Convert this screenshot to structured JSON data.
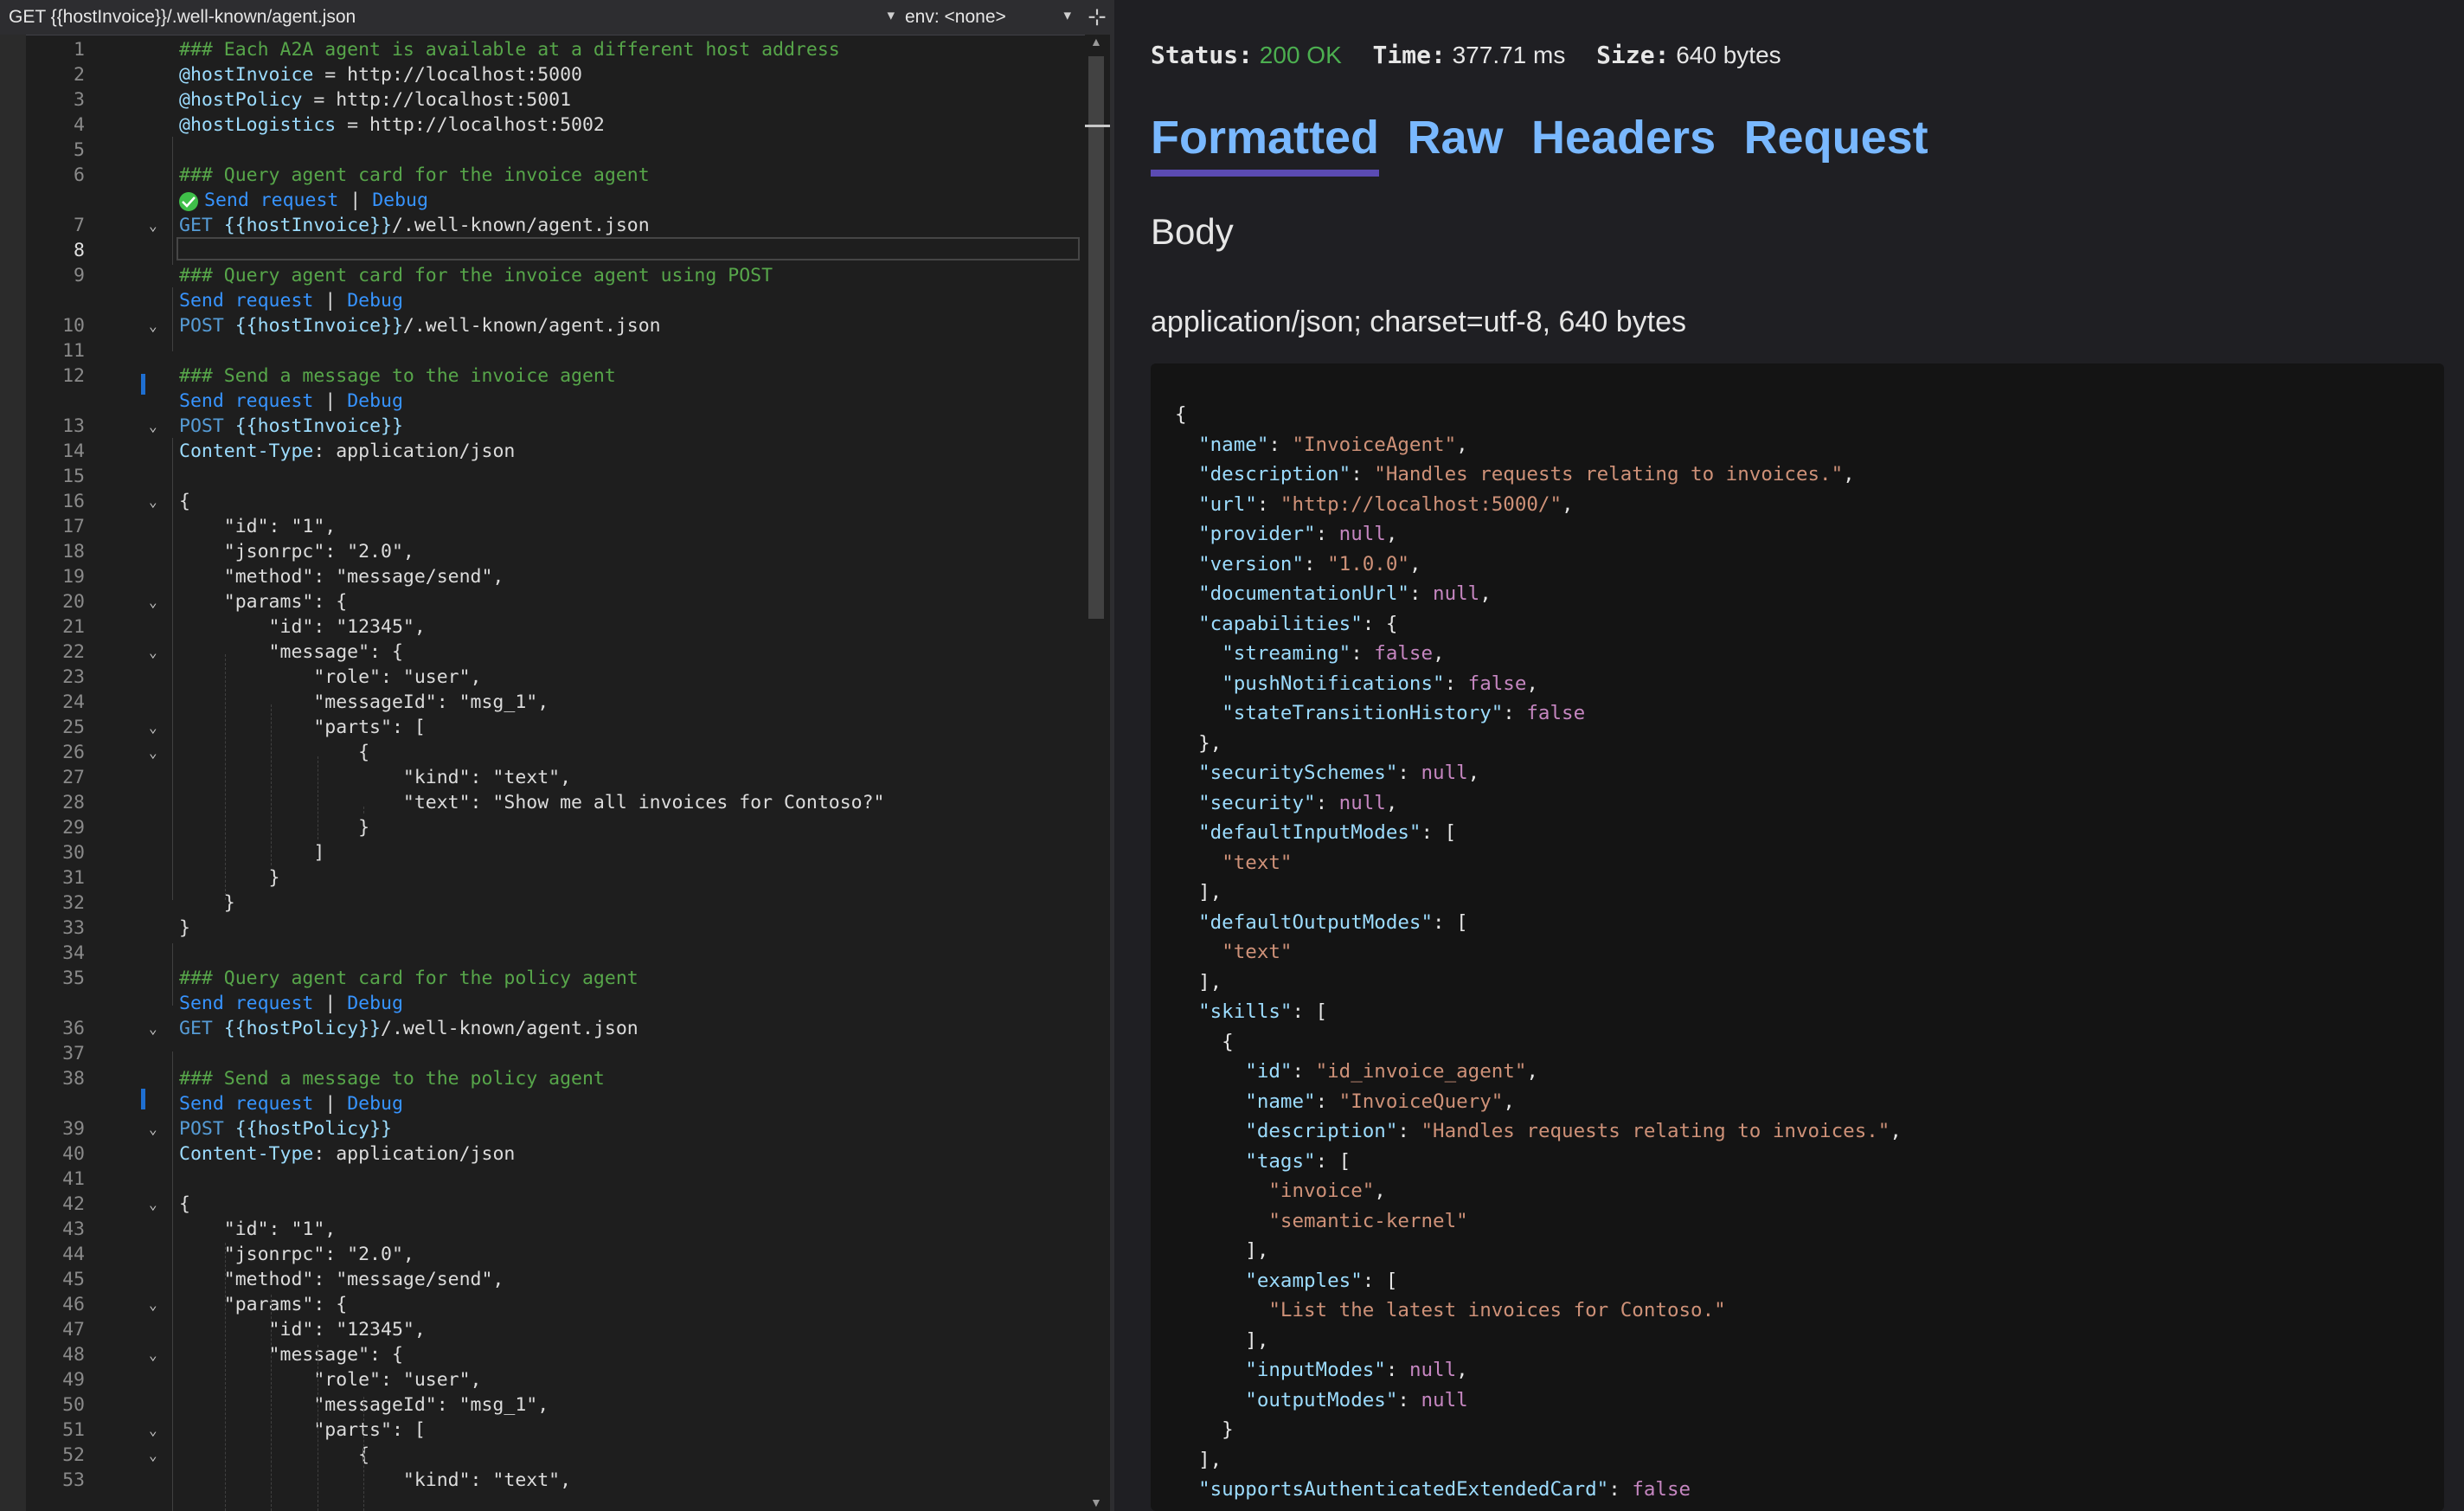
{
  "editor": {
    "request_selector": "GET {{hostInvoice}}/.well-known/agent.json",
    "env_selector": "env: <none>",
    "lines": [
      {
        "n": "1",
        "parts": [
          [
            "comment",
            "### Each A2A agent is available at a different host address"
          ]
        ]
      },
      {
        "n": "2",
        "parts": [
          [
            "var",
            "@hostInvoice"
          ],
          [
            "white",
            " = http://localhost:5000"
          ]
        ]
      },
      {
        "n": "3",
        "parts": [
          [
            "var",
            "@hostPolicy"
          ],
          [
            "white",
            " = http://localhost:5001"
          ]
        ]
      },
      {
        "n": "4",
        "parts": [
          [
            "var",
            "@hostLogistics"
          ],
          [
            "white",
            " = http://localhost:5002"
          ]
        ]
      },
      {
        "n": "5",
        "parts": []
      },
      {
        "n": "6",
        "parts": [
          [
            "comment",
            "### Query agent card for the invoice agent"
          ]
        ]
      },
      {
        "n": "",
        "codelens": true,
        "check": true,
        "send": "Send request",
        "debug": "Debug"
      },
      {
        "n": "7",
        "fold": true,
        "parts": [
          [
            "kw",
            "GET "
          ],
          [
            "var",
            "{{hostInvoice}}"
          ],
          [
            "white",
            "/.well-known/agent.json"
          ]
        ]
      },
      {
        "n": "8",
        "current": true,
        "parts": []
      },
      {
        "n": "9",
        "parts": [
          [
            "comment",
            "### Query agent card for the invoice agent using POST"
          ]
        ]
      },
      {
        "n": "",
        "codelens": true,
        "send": "Send request",
        "debug": "Debug"
      },
      {
        "n": "10",
        "fold": true,
        "parts": [
          [
            "kw",
            "POST "
          ],
          [
            "var",
            "{{hostInvoice}}"
          ],
          [
            "white",
            "/.well-known/agent.json"
          ]
        ]
      },
      {
        "n": "11",
        "parts": []
      },
      {
        "n": "12",
        "parts": [
          [
            "comment",
            "### Send a message to the invoice agent"
          ]
        ]
      },
      {
        "n": "",
        "codelens": true,
        "send": "Send request",
        "debug": "Debug"
      },
      {
        "n": "13",
        "fold": true,
        "parts": [
          [
            "kw",
            "POST "
          ],
          [
            "var",
            "{{hostInvoice}}"
          ]
        ]
      },
      {
        "n": "14",
        "parts": [
          [
            "var",
            "Content-Type"
          ],
          [
            "white",
            ": application/json"
          ]
        ]
      },
      {
        "n": "15",
        "parts": []
      },
      {
        "n": "16",
        "fold": true,
        "parts": [
          [
            "white",
            "{"
          ]
        ]
      },
      {
        "n": "17",
        "parts": [
          [
            "white",
            "    \"id\": \"1\","
          ]
        ]
      },
      {
        "n": "18",
        "parts": [
          [
            "white",
            "    \"jsonrpc\": \"2.0\","
          ]
        ]
      },
      {
        "n": "19",
        "parts": [
          [
            "white",
            "    \"method\": \"message/send\","
          ]
        ]
      },
      {
        "n": "20",
        "fold": true,
        "parts": [
          [
            "white",
            "    \"params\": {"
          ]
        ]
      },
      {
        "n": "21",
        "parts": [
          [
            "white",
            "        \"id\": \"12345\","
          ]
        ]
      },
      {
        "n": "22",
        "fold": true,
        "parts": [
          [
            "white",
            "        \"message\": {"
          ]
        ]
      },
      {
        "n": "23",
        "parts": [
          [
            "white",
            "            \"role\": \"user\","
          ]
        ]
      },
      {
        "n": "24",
        "parts": [
          [
            "white",
            "            \"messageId\": \"msg_1\","
          ]
        ]
      },
      {
        "n": "25",
        "fold": true,
        "parts": [
          [
            "white",
            "            \"parts\": ["
          ]
        ]
      },
      {
        "n": "26",
        "fold": true,
        "parts": [
          [
            "white",
            "                {"
          ]
        ]
      },
      {
        "n": "27",
        "parts": [
          [
            "white",
            "                    \"kind\": \"text\","
          ]
        ]
      },
      {
        "n": "28",
        "parts": [
          [
            "white",
            "                    \"text\": \"Show me all invoices for Contoso?\""
          ]
        ]
      },
      {
        "n": "29",
        "parts": [
          [
            "white",
            "                }"
          ]
        ]
      },
      {
        "n": "30",
        "parts": [
          [
            "white",
            "            ]"
          ]
        ]
      },
      {
        "n": "31",
        "parts": [
          [
            "white",
            "        }"
          ]
        ]
      },
      {
        "n": "32",
        "parts": [
          [
            "white",
            "    }"
          ]
        ]
      },
      {
        "n": "33",
        "parts": [
          [
            "white",
            "}"
          ]
        ]
      },
      {
        "n": "34",
        "parts": []
      },
      {
        "n": "35",
        "parts": [
          [
            "comment",
            "### Query agent card for the policy agent"
          ]
        ]
      },
      {
        "n": "",
        "codelens": true,
        "send": "Send request",
        "debug": "Debug"
      },
      {
        "n": "36",
        "fold": true,
        "parts": [
          [
            "kw",
            "GET "
          ],
          [
            "var",
            "{{hostPolicy}}"
          ],
          [
            "white",
            "/.well-known/agent.json"
          ]
        ]
      },
      {
        "n": "37",
        "parts": []
      },
      {
        "n": "38",
        "parts": [
          [
            "comment",
            "### Send a message to the policy agent"
          ]
        ]
      },
      {
        "n": "",
        "codelens": true,
        "send": "Send request",
        "debug": "Debug"
      },
      {
        "n": "39",
        "fold": true,
        "parts": [
          [
            "kw",
            "POST "
          ],
          [
            "var",
            "{{hostPolicy}}"
          ]
        ]
      },
      {
        "n": "40",
        "parts": [
          [
            "var",
            "Content-Type"
          ],
          [
            "white",
            ": application/json"
          ]
        ]
      },
      {
        "n": "41",
        "parts": []
      },
      {
        "n": "42",
        "fold": true,
        "parts": [
          [
            "white",
            "{"
          ]
        ]
      },
      {
        "n": "43",
        "parts": [
          [
            "white",
            "    \"id\": \"1\","
          ]
        ]
      },
      {
        "n": "44",
        "parts": [
          [
            "white",
            "    \"jsonrpc\": \"2.0\","
          ]
        ]
      },
      {
        "n": "45",
        "parts": [
          [
            "white",
            "    \"method\": \"message/send\","
          ]
        ]
      },
      {
        "n": "46",
        "fold": true,
        "parts": [
          [
            "white",
            "    \"params\": {"
          ]
        ]
      },
      {
        "n": "47",
        "parts": [
          [
            "white",
            "        \"id\": \"12345\","
          ]
        ]
      },
      {
        "n": "48",
        "fold": true,
        "parts": [
          [
            "white",
            "        \"message\": {"
          ]
        ]
      },
      {
        "n": "49",
        "parts": [
          [
            "white",
            "            \"role\": \"user\","
          ]
        ]
      },
      {
        "n": "50",
        "parts": [
          [
            "white",
            "            \"messageId\": \"msg_1\","
          ]
        ]
      },
      {
        "n": "51",
        "fold": true,
        "parts": [
          [
            "white",
            "            \"parts\": ["
          ]
        ]
      },
      {
        "n": "52",
        "fold": true,
        "parts": [
          [
            "white",
            "                {"
          ]
        ]
      },
      {
        "n": "53",
        "parts": [
          [
            "white",
            "                    \"kind\": \"text\","
          ]
        ]
      }
    ]
  },
  "response": {
    "status_label": "Status:",
    "status_value": "200 OK",
    "time_label": "Time:",
    "time_value": "377.71 ms",
    "size_label": "Size:",
    "size_value": "640 bytes",
    "tabs": [
      "Formatted",
      "Raw",
      "Headers",
      "Request"
    ],
    "active_tab": "Formatted",
    "body_heading": "Body",
    "content_type": "application/json; charset=utf-8, 640 bytes",
    "json_lines": [
      [
        [
          "p",
          "{"
        ]
      ],
      [
        [
          "p",
          "  "
        ],
        [
          "k",
          "\"name\""
        ],
        [
          "p",
          ": "
        ],
        [
          "s",
          "\"InvoiceAgent\""
        ],
        [
          "p",
          ","
        ]
      ],
      [
        [
          "p",
          "  "
        ],
        [
          "k",
          "\"description\""
        ],
        [
          "p",
          ": "
        ],
        [
          "s",
          "\"Handles requests relating to invoices.\""
        ],
        [
          "p",
          ","
        ]
      ],
      [
        [
          "p",
          "  "
        ],
        [
          "k",
          "\"url\""
        ],
        [
          "p",
          ": "
        ],
        [
          "s",
          "\"http://localhost:5000/\""
        ],
        [
          "p",
          ","
        ]
      ],
      [
        [
          "p",
          "  "
        ],
        [
          "k",
          "\"provider\""
        ],
        [
          "p",
          ": "
        ],
        [
          "v",
          "null"
        ],
        [
          "p",
          ","
        ]
      ],
      [
        [
          "p",
          "  "
        ],
        [
          "k",
          "\"version\""
        ],
        [
          "p",
          ": "
        ],
        [
          "s",
          "\"1.0.0\""
        ],
        [
          "p",
          ","
        ]
      ],
      [
        [
          "p",
          "  "
        ],
        [
          "k",
          "\"documentationUrl\""
        ],
        [
          "p",
          ": "
        ],
        [
          "v",
          "null"
        ],
        [
          "p",
          ","
        ]
      ],
      [
        [
          "p",
          "  "
        ],
        [
          "k",
          "\"capabilities\""
        ],
        [
          "p",
          ": {"
        ]
      ],
      [
        [
          "p",
          "    "
        ],
        [
          "k",
          "\"streaming\""
        ],
        [
          "p",
          ": "
        ],
        [
          "v",
          "false"
        ],
        [
          "p",
          ","
        ]
      ],
      [
        [
          "p",
          "    "
        ],
        [
          "k",
          "\"pushNotifications\""
        ],
        [
          "p",
          ": "
        ],
        [
          "v",
          "false"
        ],
        [
          "p",
          ","
        ]
      ],
      [
        [
          "p",
          "    "
        ],
        [
          "k",
          "\"stateTransitionHistory\""
        ],
        [
          "p",
          ": "
        ],
        [
          "v",
          "false"
        ]
      ],
      [
        [
          "p",
          "  },"
        ]
      ],
      [
        [
          "p",
          "  "
        ],
        [
          "k",
          "\"securitySchemes\""
        ],
        [
          "p",
          ": "
        ],
        [
          "v",
          "null"
        ],
        [
          "p",
          ","
        ]
      ],
      [
        [
          "p",
          "  "
        ],
        [
          "k",
          "\"security\""
        ],
        [
          "p",
          ": "
        ],
        [
          "v",
          "null"
        ],
        [
          "p",
          ","
        ]
      ],
      [
        [
          "p",
          "  "
        ],
        [
          "k",
          "\"defaultInputModes\""
        ],
        [
          "p",
          ": ["
        ]
      ],
      [
        [
          "p",
          "    "
        ],
        [
          "s",
          "\"text\""
        ]
      ],
      [
        [
          "p",
          "  ],"
        ]
      ],
      [
        [
          "p",
          "  "
        ],
        [
          "k",
          "\"defaultOutputModes\""
        ],
        [
          "p",
          ": ["
        ]
      ],
      [
        [
          "p",
          "    "
        ],
        [
          "s",
          "\"text\""
        ]
      ],
      [
        [
          "p",
          "  ],"
        ]
      ],
      [
        [
          "p",
          "  "
        ],
        [
          "k",
          "\"skills\""
        ],
        [
          "p",
          ": ["
        ]
      ],
      [
        [
          "p",
          "    {"
        ]
      ],
      [
        [
          "p",
          "      "
        ],
        [
          "k",
          "\"id\""
        ],
        [
          "p",
          ": "
        ],
        [
          "s",
          "\"id_invoice_agent\""
        ],
        [
          "p",
          ","
        ]
      ],
      [
        [
          "p",
          "      "
        ],
        [
          "k",
          "\"name\""
        ],
        [
          "p",
          ": "
        ],
        [
          "s",
          "\"InvoiceQuery\""
        ],
        [
          "p",
          ","
        ]
      ],
      [
        [
          "p",
          "      "
        ],
        [
          "k",
          "\"description\""
        ],
        [
          "p",
          ": "
        ],
        [
          "s",
          "\"Handles requests relating to invoices.\""
        ],
        [
          "p",
          ","
        ]
      ],
      [
        [
          "p",
          "      "
        ],
        [
          "k",
          "\"tags\""
        ],
        [
          "p",
          ": ["
        ]
      ],
      [
        [
          "p",
          "        "
        ],
        [
          "s",
          "\"invoice\""
        ],
        [
          "p",
          ","
        ]
      ],
      [
        [
          "p",
          "        "
        ],
        [
          "s",
          "\"semantic-kernel\""
        ]
      ],
      [
        [
          "p",
          "      ],"
        ]
      ],
      [
        [
          "p",
          "      "
        ],
        [
          "k",
          "\"examples\""
        ],
        [
          "p",
          ": ["
        ]
      ],
      [
        [
          "p",
          "        "
        ],
        [
          "s",
          "\"List the latest invoices for Contoso.\""
        ]
      ],
      [
        [
          "p",
          "      ],"
        ]
      ],
      [
        [
          "p",
          "      "
        ],
        [
          "k",
          "\"inputModes\""
        ],
        [
          "p",
          ": "
        ],
        [
          "v",
          "null"
        ],
        [
          "p",
          ","
        ]
      ],
      [
        [
          "p",
          "      "
        ],
        [
          "k",
          "\"outputModes\""
        ],
        [
          "p",
          ": "
        ],
        [
          "v",
          "null"
        ]
      ],
      [
        [
          "p",
          "    }"
        ]
      ],
      [
        [
          "p",
          "  ],"
        ]
      ],
      [
        [
          "p",
          "  "
        ],
        [
          "k",
          "\"supportsAuthenticatedExtendedCard\""
        ],
        [
          "p",
          ": "
        ],
        [
          "v",
          "false"
        ]
      ],
      [
        [
          "p",
          "}"
        ]
      ]
    ]
  }
}
